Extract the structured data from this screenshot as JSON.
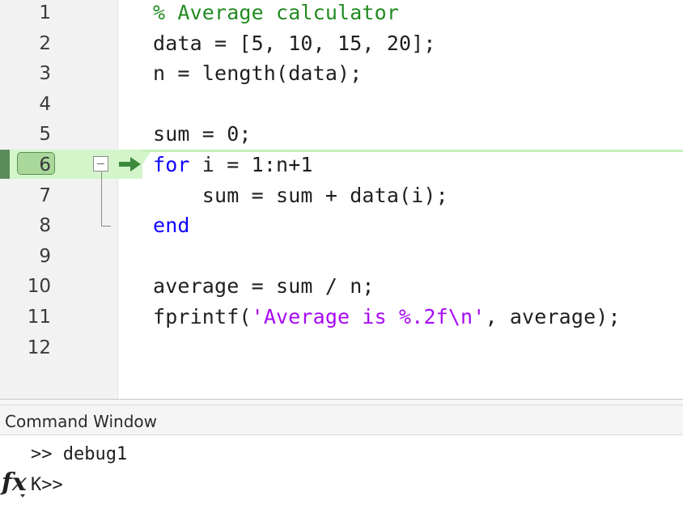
{
  "editor": {
    "current_line": 6,
    "lines": [
      {
        "number": "1",
        "tokens": [
          {
            "text": "% Average calculator",
            "kind": "comment"
          }
        ]
      },
      {
        "number": "2",
        "tokens": [
          {
            "text": "data = [5, 10, 15, 20];",
            "kind": "plain"
          }
        ]
      },
      {
        "number": "3",
        "tokens": [
          {
            "text": "n = length(data);",
            "kind": "plain"
          }
        ]
      },
      {
        "number": "4",
        "tokens": []
      },
      {
        "number": "5",
        "tokens": [
          {
            "text": "sum = 0;",
            "kind": "plain"
          }
        ]
      },
      {
        "number": "6",
        "tokens": [
          {
            "text": "for",
            "kind": "keyword"
          },
          {
            "text": " i = 1:n+1",
            "kind": "plain"
          }
        ]
      },
      {
        "number": "7",
        "tokens": [
          {
            "text": "    sum = sum + data(i);",
            "kind": "plain"
          }
        ]
      },
      {
        "number": "8",
        "tokens": [
          {
            "text": "end",
            "kind": "keyword"
          }
        ]
      },
      {
        "number": "9",
        "tokens": []
      },
      {
        "number": "10",
        "tokens": [
          {
            "text": "average = sum / n;",
            "kind": "plain"
          }
        ]
      },
      {
        "number": "11",
        "tokens": [
          {
            "text": "fprintf(",
            "kind": "plain"
          },
          {
            "text": "'Average is %.2f\\n'",
            "kind": "string"
          },
          {
            "text": ", average);",
            "kind": "plain"
          }
        ]
      },
      {
        "number": "12",
        "tokens": []
      }
    ],
    "icons": {
      "fold": "fold-collapse-icon",
      "debug": "debug-current-line-arrow-icon"
    }
  },
  "colors": {
    "comment": "#228b22",
    "keyword": "#0e00ff",
    "string": "#a709f5",
    "current_line": "#d3f5c9",
    "debug_arrow": "#3c8a3c"
  },
  "command_window": {
    "title": "Command Window",
    "lines": [
      ">> debug1",
      "K>>"
    ],
    "function_icon_label": "fx"
  }
}
